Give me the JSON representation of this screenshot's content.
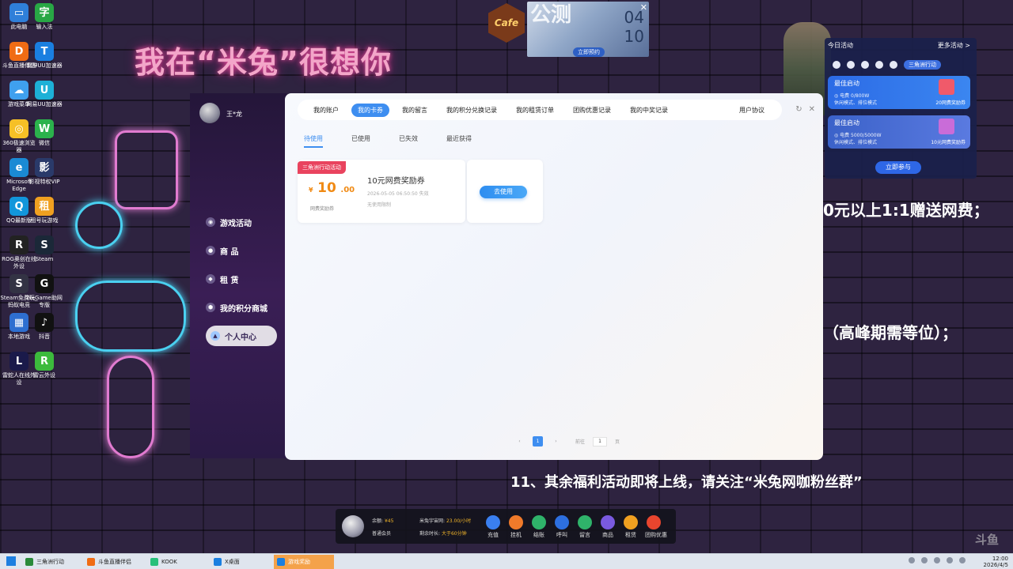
{
  "wall": {
    "headline": "我在“米兔”很想你",
    "right_line1": "0元以上1:1赠送网费；",
    "right_line2": "（高峰期需等位）；",
    "right_line3": "11、其余福利活动即将上线，请关注“米兔网咖粉丝群”"
  },
  "desktop_icons": [
    {
      "label": "此电脑",
      "glyph": "▭",
      "color": "#2f7fd9"
    },
    {
      "label": "输入法",
      "glyph": "字",
      "color": "#28a745"
    },
    {
      "label": "斗鱼直播伴侣",
      "glyph": "D",
      "color": "#f06c14"
    },
    {
      "label": "雷神UU加速器",
      "glyph": "T",
      "color": "#1a7fe0"
    },
    {
      "label": "游戏菜单",
      "glyph": "☁",
      "color": "#3fa0ee"
    },
    {
      "label": "网易UU加速器",
      "glyph": "U",
      "color": "#1db0d7"
    },
    {
      "label": "360极速浏览器",
      "glyph": "◎",
      "color": "#f6c026"
    },
    {
      "label": "微信",
      "glyph": "W",
      "color": "#2bb24c"
    },
    {
      "label": "Microsoft Edge",
      "glyph": "e",
      "color": "#1a8ad4"
    },
    {
      "label": "影视特权VIP",
      "glyph": "影",
      "color": "#2a3a6a"
    },
    {
      "label": "QQ最新版",
      "glyph": "Q",
      "color": "#1296db"
    },
    {
      "label": "租号玩游戏",
      "glyph": "租",
      "color": "#f0a020"
    },
    {
      "label": "ROG奥创在线外设",
      "glyph": "R",
      "color": "#222"
    },
    {
      "label": "Steam",
      "glyph": "S",
      "color": "#1b2838"
    },
    {
      "label": "Steam免费玩_蚂蚁电竞",
      "glyph": "S",
      "color": "#334"
    },
    {
      "label": "WeGame助网专版",
      "glyph": "G",
      "color": "#111"
    },
    {
      "label": "本地游戏",
      "glyph": "▦",
      "color": "#2e6fd0"
    },
    {
      "label": "抖音",
      "glyph": "♪",
      "color": "#111"
    },
    {
      "label": "雷蛇人在线外设",
      "glyph": "L",
      "color": "#1a1a4a"
    },
    {
      "label": "雷云外设",
      "glyph": "R",
      "color": "#3cba3c"
    }
  ],
  "banner": {
    "cafe": "Cafe",
    "game_text": "公测",
    "date_top": "04",
    "date_bottom": "10",
    "button": "立即预约",
    "close": "✕"
  },
  "activity": {
    "title": "今日活动",
    "more": "更多活动 >",
    "active_chip": "三角洲行动",
    "cards": [
      {
        "title": "最佳启动",
        "line1": "◎ 电费 0/800W",
        "line2": "休闲模式、排位模式",
        "reward": "20网费奖励券",
        "color": "#2c6be6"
      },
      {
        "title": "最佳启动",
        "line1": "◎ 电费 5000/5000W",
        "line2": "休闲模式、排位模式",
        "reward": "10元网费奖励券",
        "color": "#3b62c9"
      }
    ],
    "join": "立即参与"
  },
  "sidebar": {
    "username": "王*龙",
    "items": [
      {
        "label": "游戏活动",
        "icon": "gamepad-icon"
      },
      {
        "label": "商 品",
        "icon": "goods-icon"
      },
      {
        "label": "租 赁",
        "icon": "shield-icon"
      },
      {
        "label": "我的积分商城",
        "icon": "points-icon"
      },
      {
        "label": "个人中心",
        "icon": "user-icon"
      }
    ]
  },
  "topnav": {
    "tabs": [
      "我的账户",
      "我的卡券",
      "我的留言",
      "我的积分兑换记录",
      "我的租赁订单",
      "团购优惠记录",
      "我的中奖记录"
    ],
    "active_index": 1,
    "agreement": "用户协议",
    "refresh": "↻",
    "close": "✕"
  },
  "subtabs": {
    "items": [
      "待使用",
      "已使用",
      "已失效",
      "最近获得"
    ],
    "active_index": 0
  },
  "coupon": {
    "tag": "三角洲行动活动",
    "currency": "¥",
    "amount_int": "10",
    "amount_dec": ".00",
    "type": "网费奖励券",
    "title": "10元网费奖励券",
    "expiry": "2026-05-05 06:50:50 失效",
    "limit": "无使用限制",
    "use_button": "去使用"
  },
  "pager": {
    "prev": "‹",
    "page": "1",
    "next": "›",
    "goto_label": "前往",
    "goto_value": "1",
    "page_unit": "页"
  },
  "dock": {
    "balance_label": "余额:",
    "balance_value": "¥45",
    "member": "普通会员",
    "rate_label": "米兔宇宙网:",
    "rate_value": "23.00/小时",
    "time_label": "剩余时长:",
    "time_value": "大于60分钟",
    "buttons": [
      {
        "label": "充值",
        "color": "#3a7ff0"
      },
      {
        "label": "挂机",
        "color": "#f07a2a"
      },
      {
        "label": "结账",
        "color": "#2fb36a"
      },
      {
        "label": "呼叫",
        "color": "#2d6fe0"
      },
      {
        "label": "留言",
        "color": "#2fb36a"
      },
      {
        "label": "商品",
        "color": "#7a5ae0"
      },
      {
        "label": "租赁",
        "color": "#f0a020"
      },
      {
        "label": "团购优惠",
        "color": "#e8452e"
      }
    ]
  },
  "taskbar": {
    "tasks": [
      {
        "label": "三角洲行动",
        "color": "#2a8a3a"
      },
      {
        "label": "斗鱼直播伴侣",
        "color": "#f06c14"
      },
      {
        "label": "KOOK",
        "color": "#27c07a"
      },
      {
        "label": "X桌面",
        "color": "#1a7fe0"
      },
      {
        "label": "游戏奖励",
        "color": "#1a7fe0"
      }
    ],
    "active_index": 4,
    "time": "12:00",
    "date": "2026/4/5"
  }
}
